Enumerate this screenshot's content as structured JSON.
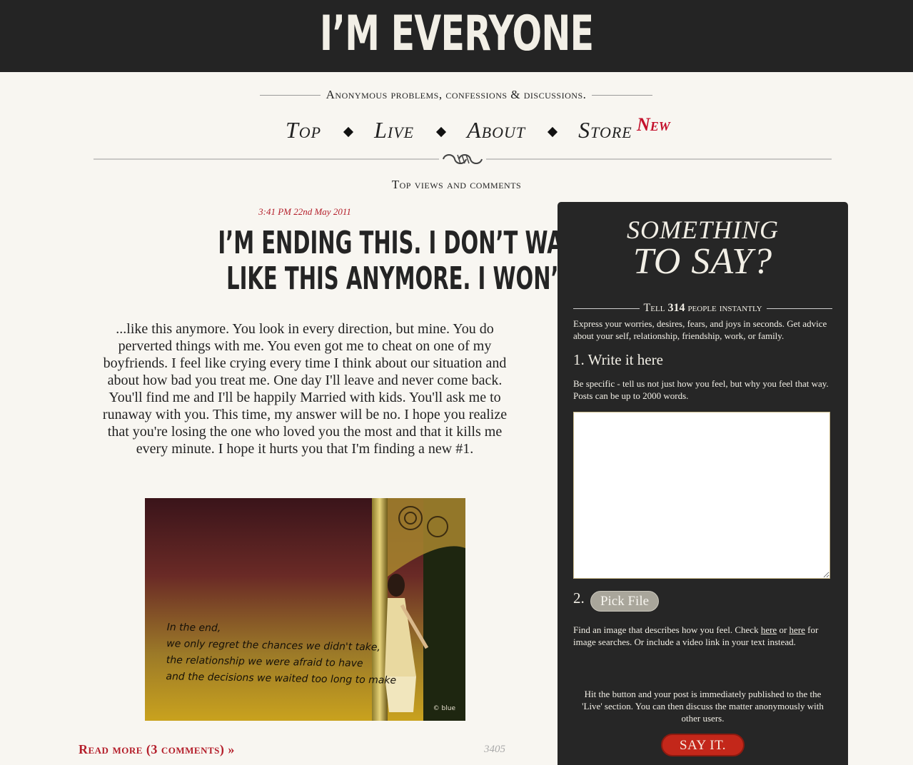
{
  "header": {
    "site_title": "I’M EVERYONE"
  },
  "tagline": "Anonymous problems, confessions & discussions.",
  "nav": {
    "items": [
      "Top",
      "Live",
      "About",
      "Store"
    ],
    "new_badge": "New"
  },
  "section_title": "Top views and comments",
  "post": {
    "timestamp": "3:41 PM 22nd May 2011",
    "title_line1": "I’M ENDING THIS. I DON’T WANT TO HURT",
    "title_line2": "LIKE THIS ANYMORE. I WON’T BE TREATED...",
    "body": "...like this anymore. You look in every direction, but mine. You do perverted things with me. You even got me to cheat on one of my boyfriends. I feel like crying every time I think about our situation and about how bad you treat me. One day I'll leave and never come back. You'll find me and I'll be happily Married with kids. You'll ask me to runaway with you. This time, my answer will be no. I hope you realize that you're losing the one who loved you the most and that it kills me every minute. I hope it hurts you that I'm finding a new #1.",
    "image_caption_lines": [
      "In the end,",
      "we only regret the chances we didn't take,",
      "the relationship we were afraid to have",
      "and the decisions we waited too long to make"
    ],
    "image_watermark": "© blue",
    "read_more": "Read more (3 comments) »",
    "views": "3405"
  },
  "sidebar": {
    "heading_line1": "SOMETHING",
    "heading_line2": "TO SAY?",
    "tell_prefix": "Tell",
    "tell_count": "314",
    "tell_suffix": "people instantly",
    "intro": "Express your worries, desires, fears, and joys in seconds. Get advice about your self, relationship, friendship, work, or family.",
    "step1_label": "1. Write it here",
    "step1_help": "Be specific - tell us not just how you feel, but why you feel that way. Posts can be up to 2000 words.",
    "textarea_value": "",
    "step2_label": "2.",
    "pick_file_label": "Pick File",
    "image_help_before": "Find an image that describes how you feel. Check",
    "link1": "here",
    "image_help_or": "or",
    "link2": "here",
    "image_help_after": "for image searches. Or include a video link in your text instead.",
    "publish_help": "Hit the button and your post is immediately published to the the 'Live' section. You can then discuss the matter anonymously with other users.",
    "submit_label": "SAY IT."
  },
  "colors": {
    "header_bg": "#242424",
    "page_bg": "#f8f6f1",
    "accent_red": "#b41e2a",
    "sidebar_bg": "#262626",
    "submit_bg": "#c3271a"
  }
}
